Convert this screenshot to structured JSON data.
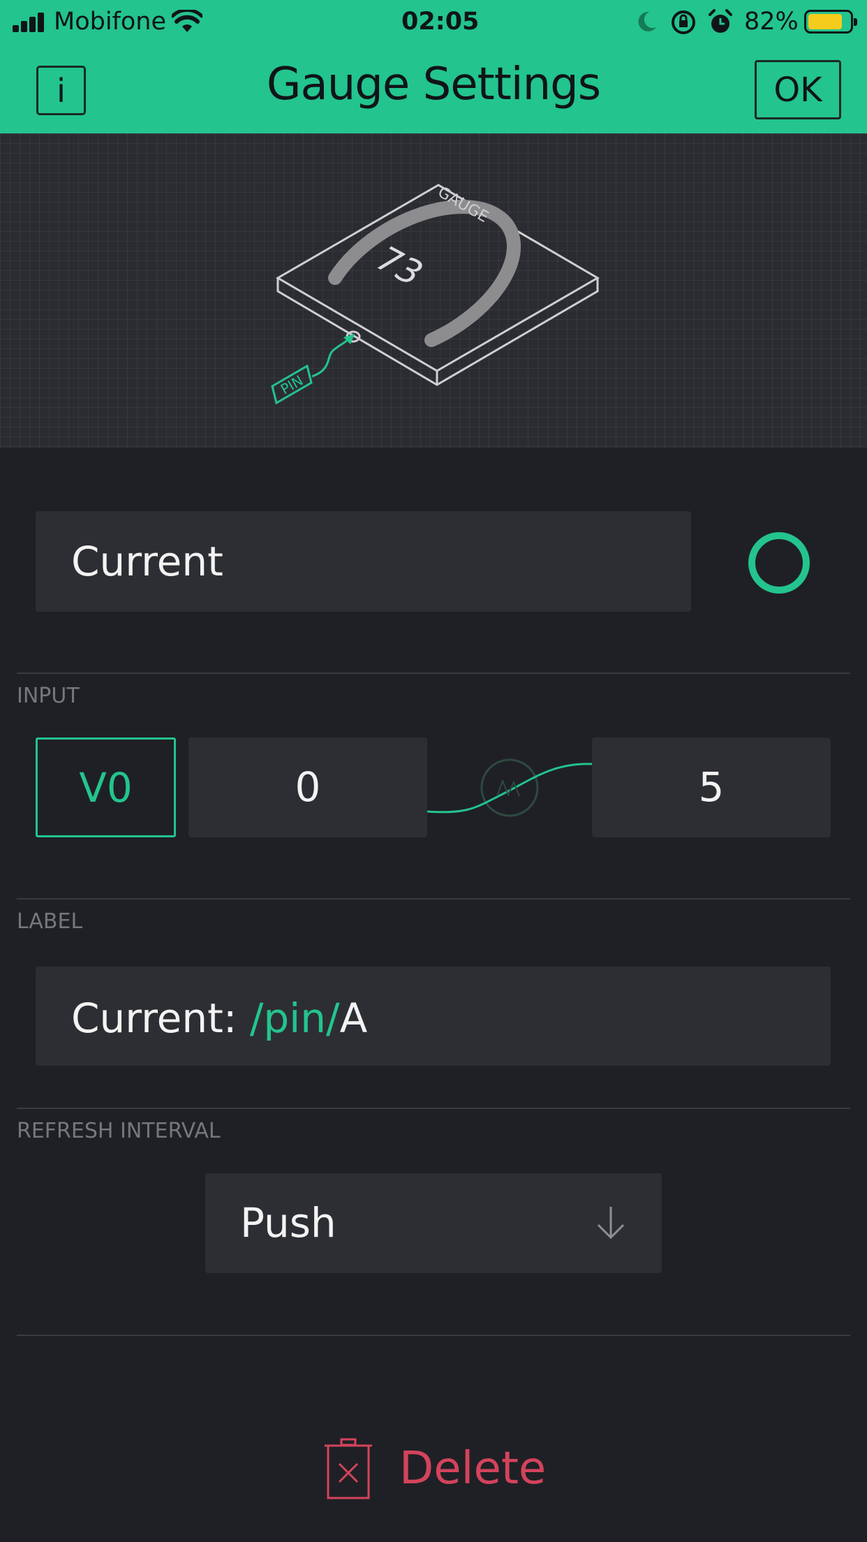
{
  "status_bar": {
    "carrier": "Mobifone",
    "time": "02:05",
    "battery_percent": "82%",
    "battery_level": 0.82,
    "icons": [
      "signal-icon",
      "wifi-icon",
      "moon-icon",
      "rotation-lock-icon",
      "alarm-icon",
      "battery-icon"
    ]
  },
  "header": {
    "info_label": "i",
    "title": "Gauge Settings",
    "ok_label": "OK",
    "background": "#23c48e"
  },
  "preview": {
    "widget_name": "GAUGE",
    "value": "73",
    "pin_tag": "PIN"
  },
  "name_field": {
    "value": "Current",
    "color": "#23c48e"
  },
  "input": {
    "section_label": "INPUT",
    "pin": "V0",
    "min": "0",
    "max": "5"
  },
  "label": {
    "section_label": "LABEL",
    "prefix": "Current: ",
    "pin_token": "/pin/",
    "suffix": "A"
  },
  "refresh": {
    "section_label": "REFRESH INTERVAL",
    "selected": "Push"
  },
  "delete": {
    "label": "Delete",
    "color": "#d3435c"
  },
  "colors": {
    "accent": "#23c48e",
    "background": "#1f2025",
    "field": "#2d2e33",
    "danger": "#d3435c"
  }
}
